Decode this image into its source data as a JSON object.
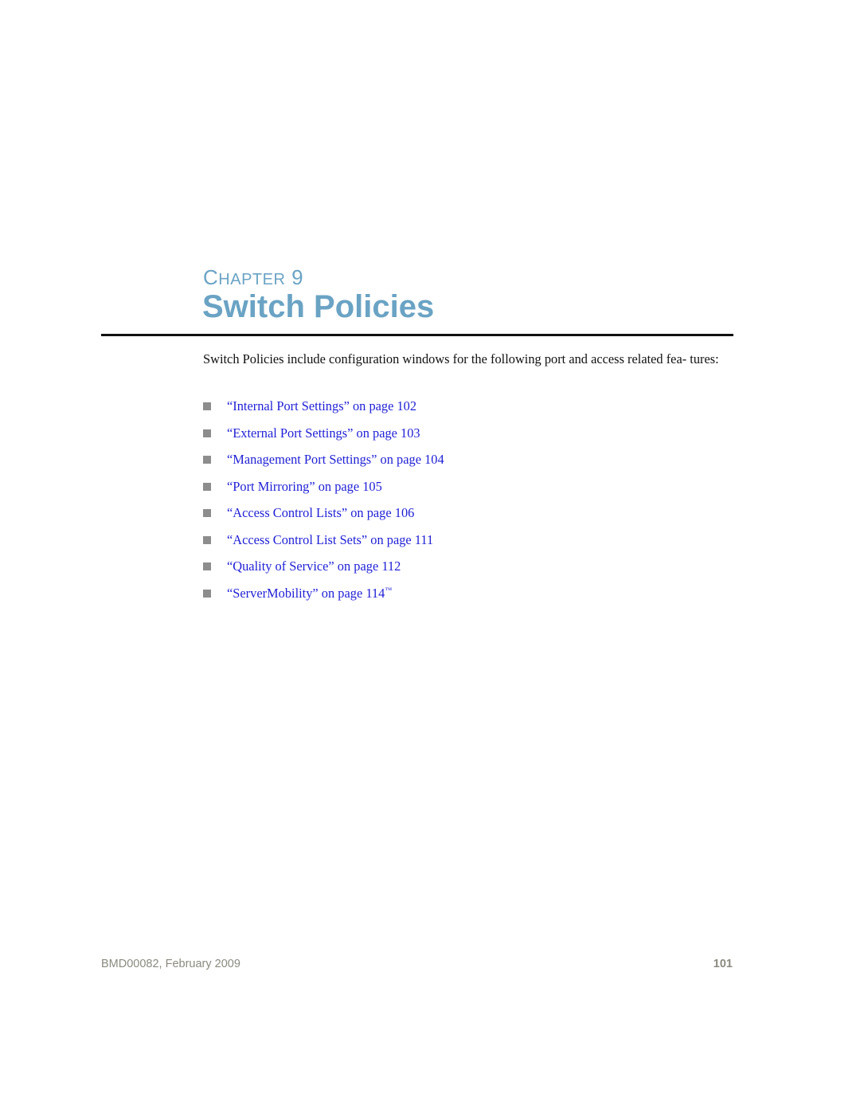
{
  "chapter": {
    "label_first_letter": "C",
    "label_rest": "HAPTER",
    "number": "9",
    "title": "Switch Policies",
    "accent_color": "#6aa3c4"
  },
  "intro": "Switch Policies include configuration windows for the following port and access related fea- tures:",
  "toc": [
    {
      "title": "“Internal Port Settings” on page 102",
      "trademark": ""
    },
    {
      "title": "“External Port Settings” on page 103",
      "trademark": ""
    },
    {
      "title": "“Management Port Settings” on page 104",
      "trademark": ""
    },
    {
      "title": "“Port Mirroring” on page 105",
      "trademark": ""
    },
    {
      "title": "“Access Control Lists” on page 106",
      "trademark": ""
    },
    {
      "title": "“Access Control List Sets” on page 111",
      "trademark": ""
    },
    {
      "title": "“Quality of Service” on page 112",
      "trademark": ""
    },
    {
      "title": "“ServerMobility” on page 114",
      "trademark": "™"
    }
  ],
  "footer": {
    "doc_id_date": "BMD00082, February 2009",
    "page_number": "101"
  },
  "colors": {
    "link": "#1f1fd6",
    "bullet": "#8d8d8d",
    "footer": "#8a8a80"
  }
}
